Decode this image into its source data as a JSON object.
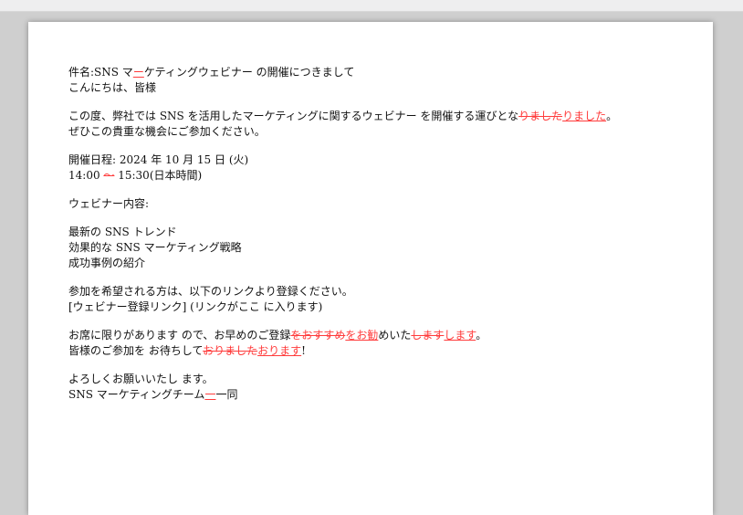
{
  "document": {
    "subject": {
      "a": "件名:SNS マ",
      "ins": "ー",
      "b": "ケティングウェビナー の開催につきまして"
    },
    "greeting": "こんにちは、皆様",
    "para1_line1": {
      "a": "この度、弊社では SNS を活用したマーケティングに関するウェビナー を開催する運びとな",
      "del": "りました",
      "ins": "りました",
      "b": "。"
    },
    "para1_line2": "ぜひこの貴重な機会にご参加ください。",
    "schedule_date": "開催日程: 2024 年 10 月 15 日 (火)",
    "schedule_time": {
      "a": "14:00 ",
      "del": "～",
      "b": " 15:30(日本時間)"
    },
    "content_label": "ウェビナー内容:",
    "items": [
      "最新の SNS トレンド",
      "効果的な SNS マーケティング戦略",
      "成功事例の紹介"
    ],
    "signup_line1": "参加を希望される方は、以下のリンクより登録ください。",
    "signup_line2": "[ウェビナー登録リンク] (リンクがここ に入ります)",
    "closing_line1": {
      "a": "お席に限りがあります ので、お早めのご登録",
      "del1": "をおすすめ",
      "ins1": "をお勧",
      "b": "めいた",
      "del2": "します",
      "ins2": "します",
      "c": "。"
    },
    "closing_line2": {
      "a": "皆様のご参加を お待ちして",
      "del": "おりました",
      "ins": "おります",
      "b": "!"
    },
    "signoff": "よろしくお願いいたし ます。",
    "team": {
      "a": "SNS マーケティングチーム",
      "ins": "一",
      "b": "一同"
    }
  }
}
